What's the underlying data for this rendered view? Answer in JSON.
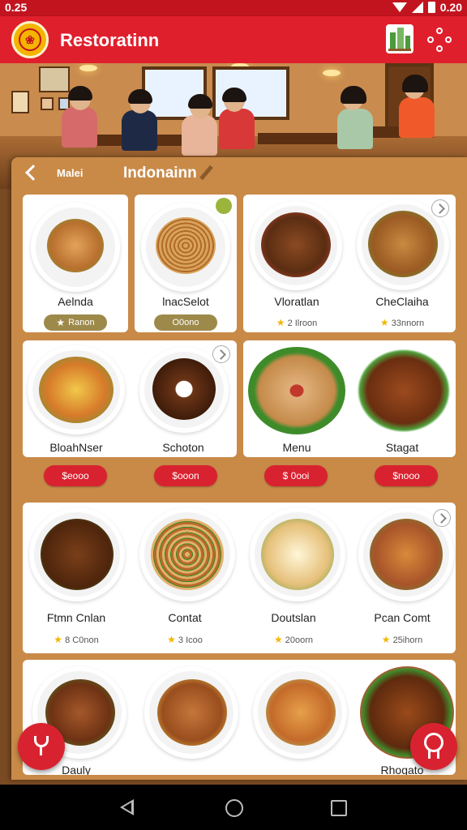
{
  "status_bar": {
    "time": "0.25",
    "battery_text": "0.20"
  },
  "app_bar": {
    "title": "Restoratinn"
  },
  "panel": {
    "breadcrumb": "Malei",
    "title": "Indonainn"
  },
  "colors": {
    "brand_red": "#e01f2d",
    "panel_tan": "#c98a48",
    "badge_olive": "#9d8a4a",
    "star_gold": "#f2b705"
  },
  "rows": [
    {
      "cards": [
        {
          "name": "Aelnda",
          "badge": "Ranon",
          "badge_style": "olive"
        },
        {
          "name": "lnacSelot",
          "badge": "O0ono",
          "badge_style": "olive"
        },
        {
          "name": "Vloratlan",
          "rating": "2 Ilroon"
        },
        {
          "name": "CheClaiha",
          "rating": "33nnorn"
        }
      ]
    },
    {
      "cards": [
        {
          "name": "BloahNser",
          "price": "$eooo"
        },
        {
          "name": "Schoton",
          "price": "$ooon"
        },
        {
          "name": "Menu",
          "price": "$ 0ooi"
        },
        {
          "name": "Stagat",
          "price": "$nooo"
        }
      ]
    },
    {
      "cards": [
        {
          "name": "Ftmn Cnlan",
          "rating": "8 C0non"
        },
        {
          "name": "Contat",
          "rating": "3 Icoo"
        },
        {
          "name": "Doutslan",
          "rating": "20oorn"
        },
        {
          "name": "Pcan Comt",
          "rating": "25ihorn"
        }
      ]
    },
    {
      "cards": [
        {
          "name": "Dauly"
        },
        {
          "name": ""
        },
        {
          "name": ""
        },
        {
          "name": "Rhogato"
        }
      ]
    }
  ]
}
